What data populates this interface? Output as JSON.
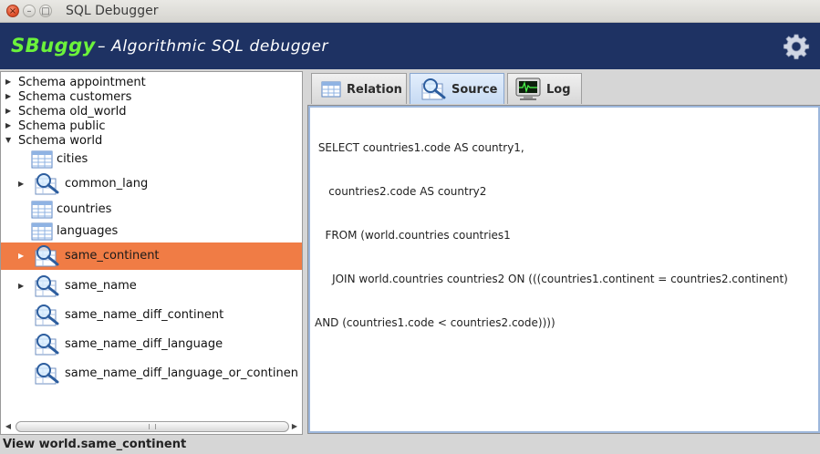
{
  "window": {
    "title": "SQL Debugger",
    "close_glyph": "×",
    "minimize_glyph": "–",
    "maximize_glyph": "□"
  },
  "header": {
    "brand": "SBuggy",
    "subtitle": "– Algorithmic SQL debugger",
    "settings_icon": "gear-icon",
    "brand_color": "#6bf23b",
    "background_color": "#1e3263"
  },
  "tree": {
    "schemas": [
      {
        "label": "Schema appointment",
        "expanded": false
      },
      {
        "label": "Schema customers",
        "expanded": false
      },
      {
        "label": "Schema old_world",
        "expanded": false
      },
      {
        "label": "Schema public",
        "expanded": false
      },
      {
        "label": "Schema world",
        "expanded": true
      }
    ],
    "items": [
      {
        "label": "cities",
        "kind": "table",
        "expandable": false,
        "selected": false
      },
      {
        "label": "common_lang",
        "kind": "view",
        "expandable": true,
        "selected": false
      },
      {
        "label": "countries",
        "kind": "table",
        "expandable": false,
        "selected": false
      },
      {
        "label": "languages",
        "kind": "table",
        "expandable": false,
        "selected": false
      },
      {
        "label": "same_continent",
        "kind": "view",
        "expandable": true,
        "selected": true
      },
      {
        "label": "same_name",
        "kind": "view",
        "expandable": true,
        "selected": false
      },
      {
        "label": "same_name_diff_continent",
        "kind": "view",
        "expandable": false,
        "selected": false
      },
      {
        "label": "same_name_diff_language",
        "kind": "view",
        "expandable": false,
        "selected": false
      },
      {
        "label": "same_name_diff_language_or_continen",
        "kind": "view",
        "expandable": false,
        "selected": false
      }
    ],
    "selection_color": "#f07c45"
  },
  "tabs": [
    {
      "label": "Relation",
      "icon": "table-icon",
      "active": false
    },
    {
      "label": "Source",
      "icon": "magnifier-icon",
      "active": true
    },
    {
      "label": "Log",
      "icon": "monitor-icon",
      "active": false
    }
  ],
  "source": {
    "lines": [
      " SELECT countries1.code AS country1,",
      "    countries2.code AS country2",
      "   FROM (world.countries countries1",
      "     JOIN world.countries countries2 ON (((countries1.continent = countries2.continent)",
      "AND (countries1.code < countries2.code))))"
    ]
  },
  "status": {
    "text": "View world.same_continent"
  }
}
